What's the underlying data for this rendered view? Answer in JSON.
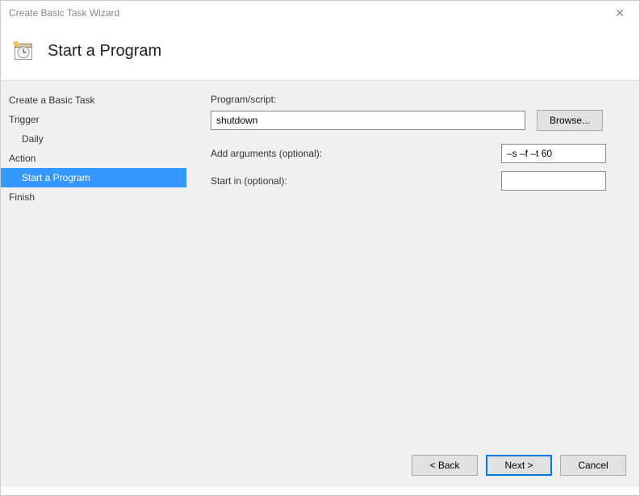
{
  "window": {
    "title": "Create Basic Task Wizard"
  },
  "header": {
    "title": "Start a Program"
  },
  "sidebar": {
    "items": [
      {
        "label": "Create a Basic Task",
        "sub": false,
        "selected": false
      },
      {
        "label": "Trigger",
        "sub": false,
        "selected": false
      },
      {
        "label": "Daily",
        "sub": true,
        "selected": false
      },
      {
        "label": "Action",
        "sub": false,
        "selected": false
      },
      {
        "label": "Start a Program",
        "sub": true,
        "selected": true
      },
      {
        "label": "Finish",
        "sub": false,
        "selected": false
      }
    ]
  },
  "form": {
    "program_label": "Program/script:",
    "program_value": "shutdown",
    "browse_label": "Browse...",
    "args_label": "Add arguments (optional):",
    "args_value": "–s –f –t 60",
    "startin_label": "Start in (optional):",
    "startin_value": ""
  },
  "footer": {
    "back": "< Back",
    "next": "Next >",
    "cancel": "Cancel"
  }
}
